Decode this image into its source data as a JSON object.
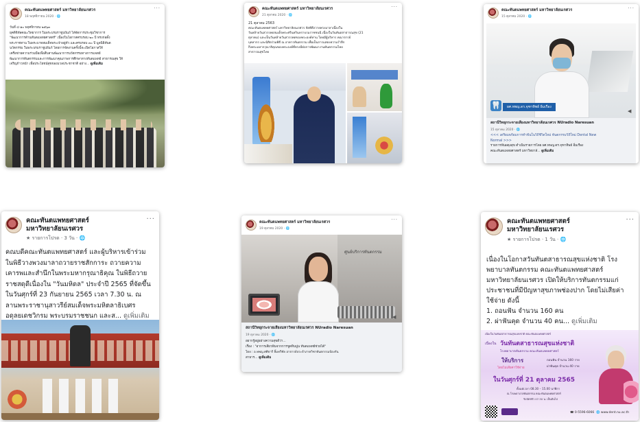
{
  "cards": [
    {
      "page": "คณะทันตแพทยศาสตร์ มหาวิทยาลัยนเรศวร",
      "date": "18 พฤศจิกายน 2020 · 🌐",
      "lines": [
        "วันที่ ๔-๑๐ พฤศจิกายน ๒๕๖๓",
        "ยุคดิจิทัลคณะวิทยาการ ในพระบรมราชูปถัมภ์ ได้จัดการประชุมวิชาการ",
        "\"พัฒนาการด้านทันตแพทยศาสตร์\" เนื่องในโอกาสครบรอบ ๒๐ ปี ทรงก่อตั้ง",
        "พระราชทาน ในพระบาทสมเด็จพระเจ้าอยู่หัว และครบรอบ ๓๐ ปี มูลนิธิทันต",
        "นวัตกรรม ในพระบรมราชูปถัมภ์ โดยการจัดงานครั้งนี้จะเปิดโอกาสให้",
        "เครือข่ายความร่วมมือเพื่อสืบสานพัฒนาการนวัตกรรมทางการแพทย์",
        "พัฒนาการทันตกรรมและการพัฒนาคุณภาพการศึกษาทางทันตแพทย์ สาธารณสุข ให้",
        "เจริญก้าวหน้า เพื่อประโยชน์สุขของมวลประชาชาติ อย่าง..."
      ],
      "see_more": "ดูเพิ่มเติม",
      "more": "···"
    },
    {
      "page": "คณะทันตแพทยศาสตร์ มหาวิทยาลัยนเรศวร",
      "date": "21 ตุลาคม 2020 · 🌐",
      "lines": [
        "21 ตุลาคม 2563",
        "คณะทันตแพทยศาสตร์ มหาวิทยาลัยนเรศวร จัดพิธีถวายพวงมาลาเนื่องใน",
        "วันคล้ายวันสวรรคตสมเด็จพระศรีนครินทราบรมราชชนนี เนื่องในวันทันตสาธารณสุข (21",
        "ตุลาคม) และเป็นวันคล้ายวันสวรรคตของพระองค์ท่าน โดยมีผู้บริหาร คณาจารย์",
        "บุคลากร และนิสิตร่วมพิธี ณ อาคารทันตกรรม เพื่อเป็นการแสดงความรำลึก",
        "ถึงพระมหากรุณาธิคุณของพระองค์ที่ทรงมีต่อการพัฒนางานทันตกรรมไทย",
        "สาธารณสุขไทย"
      ],
      "more": "···"
    },
    {
      "page": "คณะทันตแพทยศาสตร์ มหาวิทยาลัยนเรศวร",
      "date": "15 ตุลาคม 2020 · 🌐",
      "caption": "ผศ.ทพญ.ดร.จุฑาทิพย์ อิ่มเรือง",
      "link_title": "สถานีวิทยุกระจายเสียงมหาวิทยาลัยนเรศวร NUradio Naresuan",
      "link_date": "15 ตุลาคม 2020 · 🌐",
      "link_lines": [
        "<<< เตรียมพร้อมการทำฟันในวิถีชีวิตใหม่ ทันตกรรมวิถีใหม่ Dental New",
        "Normal >>>",
        "รายการฟันผดุงสุข ดำเนินรายการโดย ผศ.ทพญ.ดร.จุฑาทิพย์ อิ่มเรือง",
        "คณะทันตแพทยศาสตร์ มหาวิทยาลั..."
      ],
      "see_more": "ดูเพิ่มเติม",
      "more": "···"
    },
    {
      "page_line1": "คณะทันตแพทยศาสตร์",
      "page_line2": "มหาวิทยาลัยนเรศวร",
      "meta": "★ รายการโปรด · 3 วัน · 🌐",
      "lines": [
        "คณบดีคณะทันตแพทยศาสตร์ และผู้บริหารเข้าร่วม",
        "ในพิธีวางพวงมาลาถวายราชสักการะ ถวายความ",
        "เคารพและสำนึกในพระมหากรุณาธิคุณ ในพิธีถวาย",
        "ราชสดุดีเนื่องใน \"วันมหิดล\" ประจำปี 2565 ที่จัดขึ้น",
        "ในวันศุกร์ที่ 23 กันยายน 2565 เวลา 7.30 น. ณ",
        "ลานพระราชานุสาวรีย์สมเด็จพระมหิตลาธิเบศร",
        "อดุลยเดชวิกรม พระบรมราชชนก และส..."
      ],
      "see_more": "ดูเพิ่มเติม",
      "more": "···"
    },
    {
      "page": "คณะทันตแพทยศาสตร์ มหาวิทยาลัยนเรศวร",
      "date": "19 ตุลาคม 2020 · 🌐",
      "sign": "ศูนย์บริการทันตกรรม",
      "link_title": "สถานีวิทยุกระจายเสียงมหาวิทยาลัยนเรศวร NUradio Naresuan",
      "link_date": "19 ตุลาคม 2020 · 🌐",
      "link_lines": [
        "อยากรู้อยู่อย่างความสุขดีว่า...",
        "เรื่อง : \"อาการเสียวฟันจากการขูดหินปูน ทันตแพทย์ช่วยได้\"",
        "โดย : อ.ทพญ.ศศิธารี ลิ้มทวีชัย อาจารย์ประจำภาควิชาทันตกรรมป้องกัน",
        "สาธาร..."
      ],
      "see_more": "ดูเพิ่มเติม",
      "more": "···"
    },
    {
      "page_line1": "คณะทันตแพทยศาสตร์",
      "page_line2": "มหาวิทยาลัยนเรศวร",
      "meta": "★ รายการโปรด · 1 วัน · 🌐",
      "lines": [
        "เนื่องในโอกาสวันทันตสาธารณสุขแห่งชาติ โรง",
        "พยาบาลทันตกรรม คณะทันตแพทยศาสตร์",
        "มหาวิทยาลัยนเรศวร เปิดให้บริการทันตกรรมแก่",
        "ประชาชนที่มีปัญหาสุขภาพช่องปาก โดยไม่เสียค่า",
        "ใช้จ่าย ดังนี้",
        "1. ถอนฟัน จำนวน 160 คน",
        "2. ผ่าฟันคุด จำนวน 40 คน..."
      ],
      "see_more": "ดูเพิ่มเติม",
      "more": "···",
      "poster": {
        "top": "เนื่องในวันทันตสาธารณสุขแห่งชาติ คณะทันตแพทยศาสตร์",
        "prefix": "เนื่องใน",
        "headline": "วันทันตสาธารณสุขแห่งชาติ",
        "sub": "โรงพยาบาลทันตกรรม คณะทันตแพทยศาสตร์",
        "service": "ให้บริการ",
        "free": "โดยไม่เสียค่าใช้จ่าย",
        "item1": "ถอนฟัน จำนวน 160 ราย",
        "item2": "ผ่าฟันคุด จำนวน 40 ราย",
        "date": "ในวันศุกร์ที่ 21 ตุลาคม 2565",
        "time": "ตั้งแต่เวลา 08.30 – 15.00 นาฬิกา",
        "place": "ณ โรงพยาบาลทันตกรรม คณะทันตแพทยศาสตร์",
        "note": "รับบัตรคิว 07.30 น. เป็นต้นไป",
        "phone": "☎ 0-5596-6066",
        "web": "🌐 www.dent.nu.ac.th"
      }
    }
  ]
}
